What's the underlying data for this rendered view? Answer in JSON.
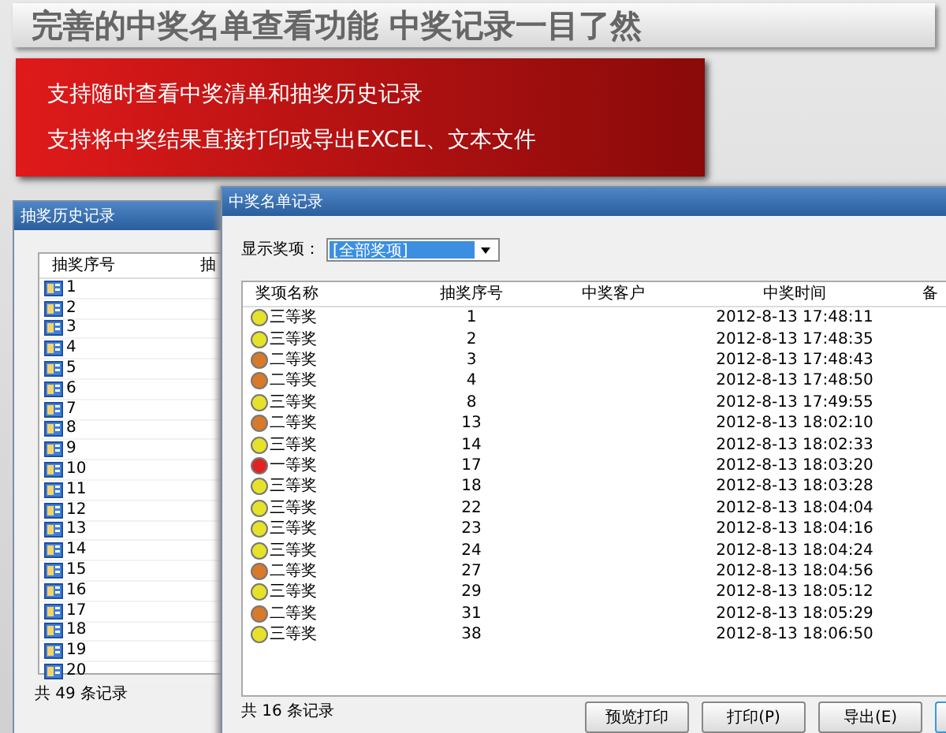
{
  "banner": {
    "title": "完善的中奖名单查看功能 中奖记录一目了然",
    "lines": [
      "支持随时查看中奖清单和抽奖历史记录",
      "支持将中奖结果直接打印或导出EXCEL、文本文件"
    ]
  },
  "history_window": {
    "title": "抽奖历史记录",
    "columns": [
      "抽奖序号",
      "抽"
    ],
    "rows": [
      "1",
      "2",
      "3",
      "4",
      "5",
      "6",
      "7",
      "8",
      "9",
      "10",
      "11",
      "12",
      "13",
      "14",
      "15",
      "16",
      "17",
      "18",
      "19",
      "20"
    ],
    "footer": "共 49 条记录"
  },
  "winners_window": {
    "title": "中奖名单记录",
    "filter_label": "显示奖项：",
    "filter_value": "[全部奖项]",
    "columns": [
      "奖项名称",
      "抽奖序号",
      "中奖客户",
      "中奖时间",
      "备"
    ],
    "rows": [
      {
        "prize": "三等奖",
        "color": "#e6e22a",
        "seq": "1",
        "time": "2012-8-13 17:48:11"
      },
      {
        "prize": "三等奖",
        "color": "#e6e22a",
        "seq": "2",
        "time": "2012-8-13 17:48:35"
      },
      {
        "prize": "二等奖",
        "color": "#d9792a",
        "seq": "3",
        "time": "2012-8-13 17:48:43"
      },
      {
        "prize": "二等奖",
        "color": "#d9792a",
        "seq": "4",
        "time": "2012-8-13 17:48:50"
      },
      {
        "prize": "三等奖",
        "color": "#e6e22a",
        "seq": "8",
        "time": "2012-8-13 17:49:55"
      },
      {
        "prize": "二等奖",
        "color": "#d9792a",
        "seq": "13",
        "time": "2012-8-13 18:02:10"
      },
      {
        "prize": "三等奖",
        "color": "#e6e22a",
        "seq": "14",
        "time": "2012-8-13 18:02:33"
      },
      {
        "prize": "一等奖",
        "color": "#e02424",
        "seq": "17",
        "time": "2012-8-13 18:03:20"
      },
      {
        "prize": "三等奖",
        "color": "#e6e22a",
        "seq": "18",
        "time": "2012-8-13 18:03:28"
      },
      {
        "prize": "三等奖",
        "color": "#e6e22a",
        "seq": "22",
        "time": "2012-8-13 18:04:04"
      },
      {
        "prize": "三等奖",
        "color": "#e6e22a",
        "seq": "23",
        "time": "2012-8-13 18:04:16"
      },
      {
        "prize": "三等奖",
        "color": "#e6e22a",
        "seq": "24",
        "time": "2012-8-13 18:04:24"
      },
      {
        "prize": "二等奖",
        "color": "#d9792a",
        "seq": "27",
        "time": "2012-8-13 18:04:56"
      },
      {
        "prize": "三等奖",
        "color": "#e6e22a",
        "seq": "29",
        "time": "2012-8-13 18:05:12"
      },
      {
        "prize": "二等奖",
        "color": "#d9792a",
        "seq": "31",
        "time": "2012-8-13 18:05:29"
      },
      {
        "prize": "三等奖",
        "color": "#e6e22a",
        "seq": "38",
        "time": "2012-8-13 18:06:50"
      }
    ],
    "footer": "共 16 条记录",
    "buttons": [
      "预览打印",
      "打印(P)",
      "导出(E)"
    ]
  }
}
